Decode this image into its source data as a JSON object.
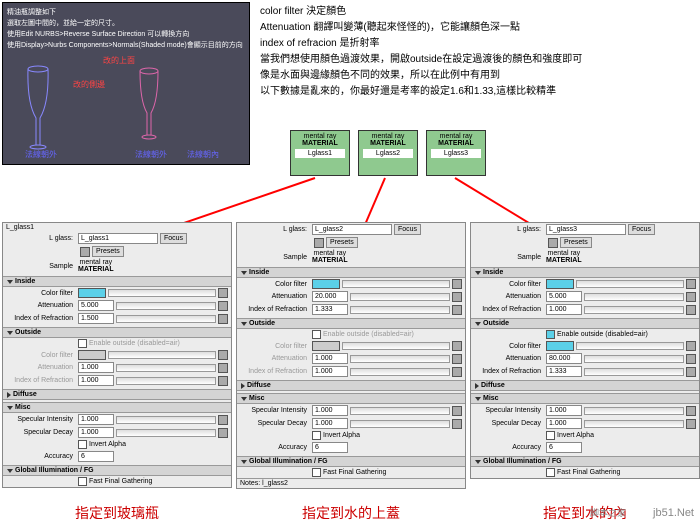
{
  "topnote": {
    "l1": "精油瓶調整如下",
    "l2": "選取左圖中間的，並給一定的尺寸。",
    "l3": "使用Edit NURBS>Reverse Surface Direction 可以轉換方向",
    "l4": "使用Display>Nurbs Components>Normals(Shaded mode)會顯示目前的方向",
    "r1": "改的上面",
    "r2": "改的側邊",
    "b1": "法線朝外",
    "b2": "法線朝外",
    "b3": "法線朝內"
  },
  "desc": {
    "l1": "color filter 決定顏色",
    "l2": "Attenuation 翻譯叫變薄(聽起來怪怪的)，它能讓顏色深一點",
    "l3": "index of refracion 是折射率",
    "l4": "當我們想使用顏色過渡效果，開啟outside在設定過渡後的顏色和強度即可",
    "l5": "像是水面與邊緣顏色不同的效果，所以在此例中有用到",
    "l6": "以下數據是亂來的，你最好還是考率的設定1.6和1.33,這樣比較精準"
  },
  "nodes": {
    "title": "mental ray",
    "mat": "MATERIAL",
    "n1": "Lglass1",
    "n2": "Lglass2",
    "n3": "Lglass3"
  },
  "labels": {
    "g1": "L_glass1",
    "g2": "L_glass2",
    "g3": "L_glass3"
  },
  "captions": {
    "c1": "指定到玻璃瓶",
    "c2": "指定到水的上蓋",
    "c3": "指定到水的內"
  },
  "panel": {
    "tab": "L_glass1",
    "lglass": "L glass:",
    "focus": "Focus",
    "presets": "Presets",
    "sample": "Sample",
    "mray": "mental ray",
    "nmat": "MATERIAL",
    "inside": "Inside",
    "outside": "Outside",
    "diffuse": "Diffuse",
    "misc": "Misc",
    "gifg": "Global Illumination / FG",
    "cf": "Color filter",
    "att": "Attenuation",
    "ior": "Index of Refraction",
    "eo": "Enable outside (disabled=air)",
    "si": "Specular Intensity",
    "sd": "Specular Decay",
    "ia": "Invert Alpha",
    "acc": "Accuracy",
    "ffg": "Fast Final Gathering",
    "notes": "Notes: l_glass2"
  },
  "v1": {
    "name": "L_glass1",
    "att": "5.000",
    "ior": "1.500",
    "oatt": "1.000",
    "oior": "1.000",
    "si": "1.000",
    "sd": "1.000",
    "acc": "6"
  },
  "v2": {
    "name": "L_glass2",
    "att": "20.000",
    "ior": "1.333",
    "oatt": "1.000",
    "oior": "1.000",
    "si": "1.000",
    "sd": "1.000",
    "acc": "6"
  },
  "v3": {
    "name": "L_glass3",
    "att": "5.000",
    "ior": "1.000",
    "oatt": "80.000",
    "oior": "1.333",
    "si": "1.000",
    "sd": "1.000",
    "acc": "6"
  },
  "wm": {
    "site": "jb51.Net",
    "txt": "脚本之家"
  }
}
